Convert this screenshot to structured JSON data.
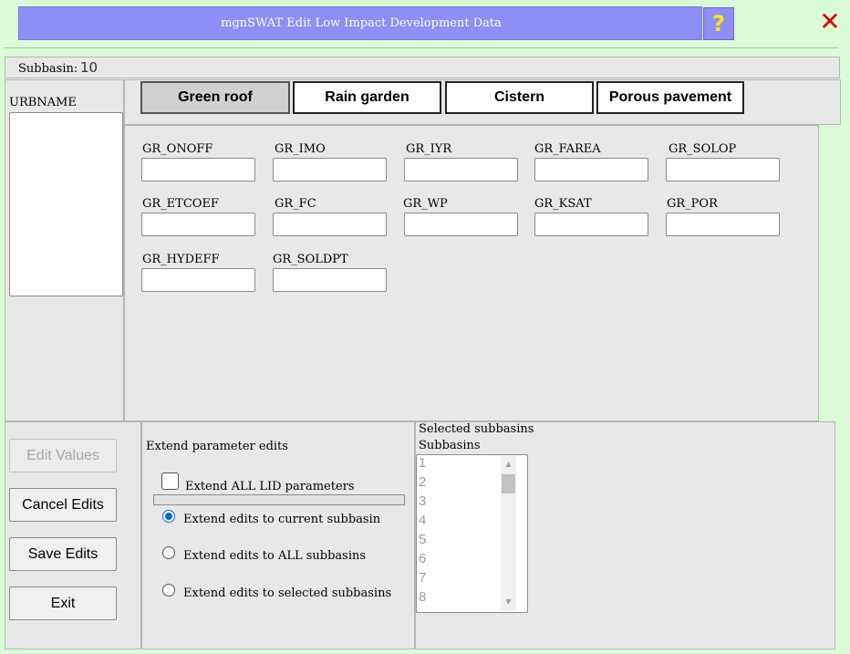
{
  "window": {
    "title": "mgnSWAT Edit Low Impact Development Data",
    "help_label": "?",
    "close_label": "✕"
  },
  "subbasin": {
    "label": "Subbasin:",
    "value": "10"
  },
  "urb": {
    "label": "URBNAME"
  },
  "tabs": [
    {
      "label": "Green roof",
      "active": true
    },
    {
      "label": "Rain garden",
      "active": false
    },
    {
      "label": "Cistern",
      "active": false
    },
    {
      "label": "Porous pavement",
      "active": false
    }
  ],
  "params": [
    {
      "label": "GR_ONOFF",
      "value": ""
    },
    {
      "label": "GR_IMO",
      "value": ""
    },
    {
      "label": "GR_IYR",
      "value": ""
    },
    {
      "label": "GR_FAREA",
      "value": ""
    },
    {
      "label": "GR_SOLOP",
      "value": ""
    },
    {
      "label": "GR_ETCOEF",
      "value": ""
    },
    {
      "label": "GR_FC",
      "value": ""
    },
    {
      "label": "GR_WP",
      "value": ""
    },
    {
      "label": "GR_KSAT",
      "value": ""
    },
    {
      "label": "GR_POR",
      "value": ""
    },
    {
      "label": "GR_HYDEFF",
      "value": ""
    },
    {
      "label": "GR_SOLDPT",
      "value": ""
    }
  ],
  "buttons": {
    "edit_values": "Edit Values",
    "cancel_edits": "Cancel Edits",
    "save_edits": "Save Edits",
    "exit": "Exit"
  },
  "extend": {
    "title": "Extend parameter edits",
    "all_lid_label": "Extend ALL LID parameters",
    "all_lid_checked": false,
    "radio_current": "Extend edits to current subbasin",
    "radio_all": "Extend edits to ALL subbasins",
    "radio_selected": "Extend edits to selected subbasins",
    "selected_option": "current"
  },
  "selected": {
    "title": "Selected subbasins",
    "list_label": "Subbasins",
    "items": [
      "1",
      "2",
      "3",
      "4",
      "5",
      "6",
      "7",
      "8"
    ]
  },
  "colors": {
    "background": "#d9fbd5",
    "titlebar": "#8e8ef5",
    "help_icon": "#ffe600",
    "close_icon": "#e00000",
    "radio_accent": "#0b64d8"
  }
}
